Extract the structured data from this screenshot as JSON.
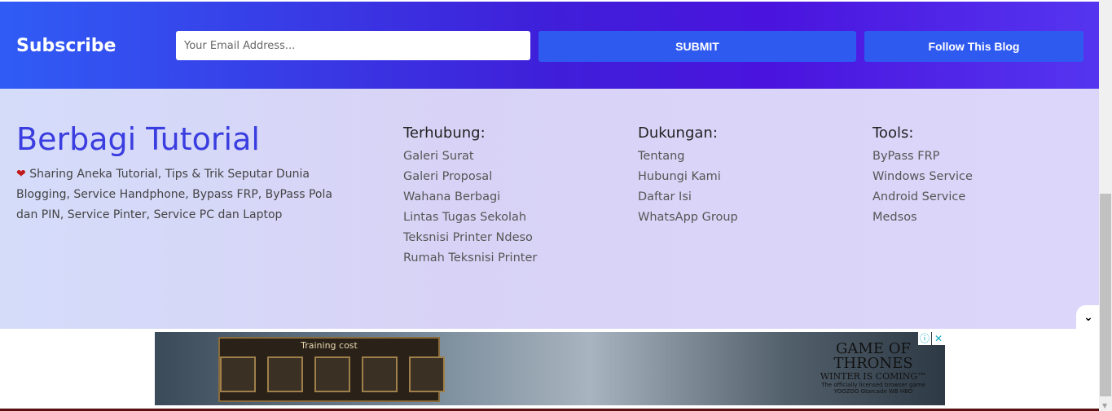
{
  "subscribe": {
    "title": "Subscribe",
    "email_placeholder": "Your Email Address...",
    "submit_label": "SUBMIT",
    "follow_label": "Follow This Blog"
  },
  "footer": {
    "brand": "Berbagi Tutorial",
    "description": "Sharing Aneka Tutorial, Tips & Trik Seputar Dunia Blogging, Service Handphone, Bypass FRP, ByPass Pola dan PIN, Service Pinter, Service PC dan Laptop",
    "columns": [
      {
        "title": "Terhubung:",
        "links": [
          "Galeri Surat",
          "Galeri Proposal",
          "Wahana Berbagi",
          "Lintas Tugas Sekolah",
          "Teksnisi Printer Ndeso",
          "Rumah Teksnisi Printer"
        ]
      },
      {
        "title": "Dukungan:",
        "links": [
          "Tentang",
          "Hubungi Kami",
          "Daftar Isi",
          "WhatsApp Group"
        ]
      },
      {
        "title": "Tools:",
        "links": [
          "ByPass FRP",
          "Windows Service",
          "Android Service",
          "Medsos"
        ]
      }
    ]
  },
  "ad": {
    "panel_title": "Training cost",
    "brand_line1": "GAME OF",
    "brand_line2": "THRONES",
    "tagline": "WINTER IS COMING™",
    "subline": "The officially licensed browser game",
    "sponsors": "YOOZOO  Gtarcade  WB  HBO"
  },
  "colors": {
    "accent": "#2f5af0",
    "brand": "#3a3ddf"
  }
}
